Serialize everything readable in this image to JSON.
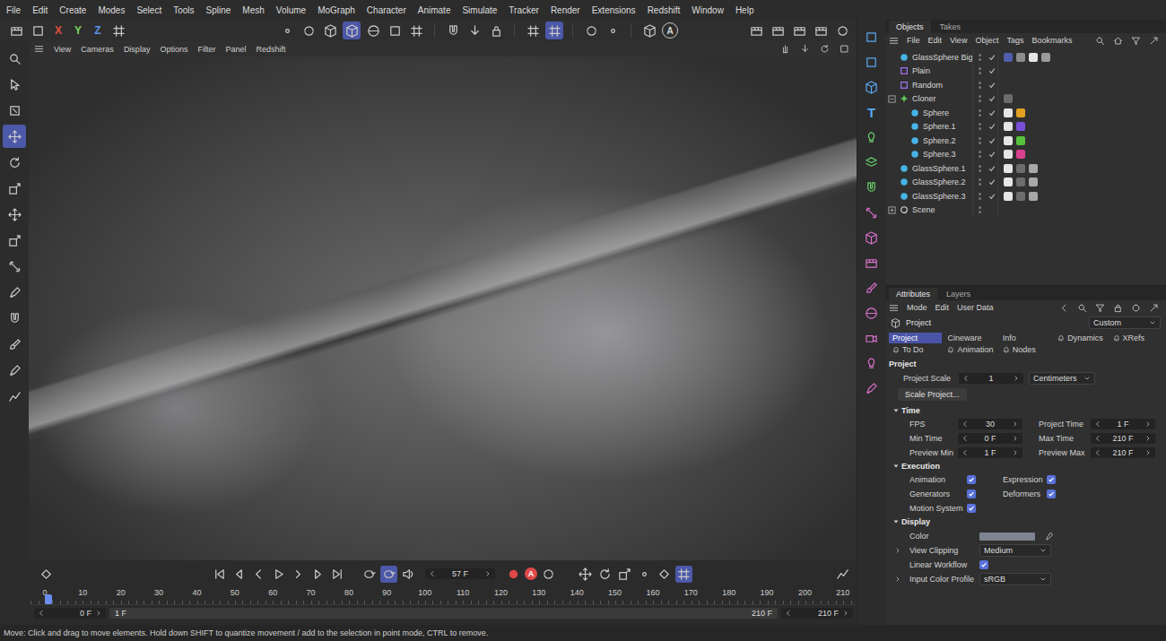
{
  "menu_bar": {
    "items": [
      "File",
      "Edit",
      "Create",
      "Modes",
      "Select",
      "Tools",
      "Spline",
      "Mesh",
      "Volume",
      "MoGraph",
      "Character",
      "Animate",
      "Simulate",
      "Tracker",
      "Render",
      "Extensions",
      "Redshift",
      "Window",
      "Help"
    ]
  },
  "toolbar": {
    "axis_buttons": [
      {
        "label": "X",
        "color": "#e0503f"
      },
      {
        "label": "Y",
        "color": "#79d35d"
      },
      {
        "label": "Z",
        "color": "#5a95ea"
      }
    ],
    "mode_buttons": [
      {
        "selected": false
      },
      {
        "selected": false
      },
      {
        "selected": false
      },
      {
        "selected": true
      },
      {
        "selected": false
      },
      {
        "selected": false
      },
      {
        "selected": false
      }
    ],
    "snap_buttons": [
      {
        "selected": false
      },
      {
        "selected": true
      }
    ],
    "letter_button": "A"
  },
  "tools": {
    "items": [
      {
        "selected": false
      },
      {
        "selected": false
      },
      {
        "selected": false
      },
      {
        "selected": true
      },
      {
        "selected": false
      },
      {
        "selected": false
      },
      {
        "selected": false
      },
      {
        "selected": false
      },
      {
        "selected": false
      },
      {
        "selected": false
      },
      {
        "selected": false
      },
      {
        "selected": false
      },
      {
        "selected": false
      },
      {
        "selected": false
      }
    ]
  },
  "viewport_menu": {
    "items": [
      "View",
      "Cameras",
      "Display",
      "Options",
      "Filter",
      "Panel",
      "Redshift"
    ]
  },
  "timeline": {
    "current_frame": "57 F",
    "record_label": "A",
    "loop_buttons": [
      {
        "selected": false
      },
      {
        "selected": true
      }
    ],
    "key_buttons": [
      {
        "selected": false
      },
      {
        "selected": false
      },
      {
        "selected": false
      },
      {
        "selected": false
      },
      {
        "selected": false
      },
      {
        "selected": true
      }
    ],
    "ticks": [
      "0",
      "10",
      "20",
      "30",
      "40",
      "50",
      "60",
      "70",
      "80",
      "90",
      "100",
      "110",
      "120",
      "130",
      "140",
      "150",
      "160",
      "170",
      "180",
      "190",
      "200",
      "210"
    ],
    "playhead_level": 0.005,
    "range": {
      "start": "0 F",
      "preview_start": "1 F",
      "preview_end": "210 F",
      "end": "210 F"
    }
  },
  "right_strip": {
    "text_tool_label": "T"
  },
  "objects_panel": {
    "tabs": [
      {
        "label": "Objects",
        "selected": true
      },
      {
        "label": "Takes",
        "selected": false
      }
    ],
    "menu": [
      "File",
      "Edit",
      "View",
      "Object",
      "Tags",
      "Bookmarks"
    ],
    "rows": [
      {
        "name": "GlassSphere Big",
        "depth": 0,
        "kind": "sphere",
        "expandable": false,
        "expanded": false,
        "enabled": true,
        "tags": [
          "#4f5fae",
          "#8d8d8d",
          "#e6e6e6",
          "#9a9a9a"
        ]
      },
      {
        "name": "Plain",
        "depth": 0,
        "kind": "effector",
        "expandable": false,
        "expanded": false,
        "enabled": true,
        "tags": []
      },
      {
        "name": "Random",
        "depth": 0,
        "kind": "effector",
        "expandable": false,
        "expanded": false,
        "enabled": true,
        "tags": []
      },
      {
        "name": "Cloner",
        "depth": 0,
        "kind": "cloner",
        "expandable": true,
        "expanded": true,
        "enabled": true,
        "tags": [
          "#6c6c6c"
        ]
      },
      {
        "name": "Sphere",
        "depth": 1,
        "kind": "sphere",
        "expandable": false,
        "expanded": false,
        "enabled": true,
        "tags": [
          "#e6e6e6",
          "#e0a21e"
        ]
      },
      {
        "name": "Sphere.1",
        "depth": 1,
        "kind": "sphere",
        "expandable": false,
        "expanded": false,
        "enabled": true,
        "tags": [
          "#e6e6e6",
          "#7a4fd8"
        ]
      },
      {
        "name": "Sphere.2",
        "depth": 1,
        "kind": "sphere",
        "expandable": false,
        "expanded": false,
        "enabled": true,
        "tags": [
          "#e6e6e6",
          "#57c23c"
        ]
      },
      {
        "name": "Sphere.3",
        "depth": 1,
        "kind": "sphere",
        "expandable": false,
        "expanded": false,
        "enabled": true,
        "tags": [
          "#e6e6e6",
          "#d8408f"
        ]
      },
      {
        "name": "GlassSphere.1",
        "depth": 0,
        "kind": "sphere",
        "expandable": false,
        "expanded": false,
        "enabled": true,
        "tags": [
          "#e6e6e6",
          "#6c6c6c",
          "#a8a8a8"
        ]
      },
      {
        "name": "GlassSphere.2",
        "depth": 0,
        "kind": "sphere",
        "expandable": false,
        "expanded": false,
        "enabled": true,
        "tags": [
          "#e6e6e6",
          "#6c6c6c",
          "#a8a8a8"
        ]
      },
      {
        "name": "GlassSphere.3",
        "depth": 0,
        "kind": "sphere",
        "expandable": false,
        "expanded": false,
        "enabled": true,
        "tags": [
          "#e6e6e6",
          "#6c6c6c",
          "#a8a8a8"
        ]
      },
      {
        "name": "Scene",
        "depth": 0,
        "kind": "scene",
        "expandable": true,
        "expanded": false,
        "enabled": false,
        "tags": []
      }
    ]
  },
  "attributes_panel": {
    "tabs": [
      {
        "label": "Attributes",
        "selected": true
      },
      {
        "label": "Layers",
        "selected": false
      }
    ],
    "menu": [
      "Mode",
      "Edit",
      "User Data"
    ],
    "object_label": "Project",
    "mode_dropdown": "Custom",
    "page_tabs": [
      {
        "label": "Project",
        "selected": true,
        "kind": "plain"
      },
      {
        "label": "Cineware",
        "selected": false,
        "kind": "plain"
      },
      {
        "label": "Info",
        "selected": false,
        "kind": "plain"
      },
      {
        "label": "Dynamics",
        "selected": false,
        "kind": "icon"
      },
      {
        "label": "XRefs",
        "selected": false,
        "kind": "icon"
      },
      {
        "label": "To Do",
        "selected": false,
        "kind": "icon"
      },
      {
        "label": "Animation",
        "selected": false,
        "kind": "icon"
      },
      {
        "label": "Nodes",
        "selected": false,
        "kind": "icon"
      }
    ],
    "project_section": {
      "title": "Project",
      "scale_label": "Project Scale",
      "scale_value": "1",
      "unit": "Centimeters",
      "button": "Scale Project..."
    },
    "time_section": {
      "title": "Time",
      "expanded": true,
      "fields": [
        {
          "label": "FPS",
          "value": "30"
        },
        {
          "label": "Project Time",
          "value": "1 F"
        },
        {
          "label": "Min Time",
          "value": "0 F"
        },
        {
          "label": "Max Time",
          "value": "210 F"
        },
        {
          "label": "Preview Min",
          "value": "1 F"
        },
        {
          "label": "Preview Max",
          "value": "210 F"
        }
      ]
    },
    "execution_section": {
      "title": "Execution",
      "expanded": true,
      "options": [
        {
          "label": "Animation",
          "checked": true
        },
        {
          "label": "Expression",
          "checked": true
        },
        {
          "label": "Generators",
          "checked": true
        },
        {
          "label": "Deformers",
          "checked": true
        },
        {
          "label": "Motion System",
          "checked": true
        }
      ]
    },
    "display_section": {
      "title": "Display",
      "expanded": true,
      "rows": [
        {
          "label": "Color",
          "kind": "color",
          "expandable": false,
          "value": "#7e8591"
        },
        {
          "label": "View Clipping",
          "kind": "dropdown",
          "expandable": true,
          "value": "Medium"
        },
        {
          "label": "Linear Workflow",
          "kind": "checkbox",
          "expandable": false,
          "checked": true
        },
        {
          "label": "Input Color Profile",
          "kind": "dropdown",
          "expandable": true,
          "value": "sRGB"
        }
      ]
    }
  },
  "status_bar": {
    "text": "Move: Click and drag to move elements. Hold down SHIFT to quantize movement / add to the selection in point mode, CTRL to remove."
  }
}
